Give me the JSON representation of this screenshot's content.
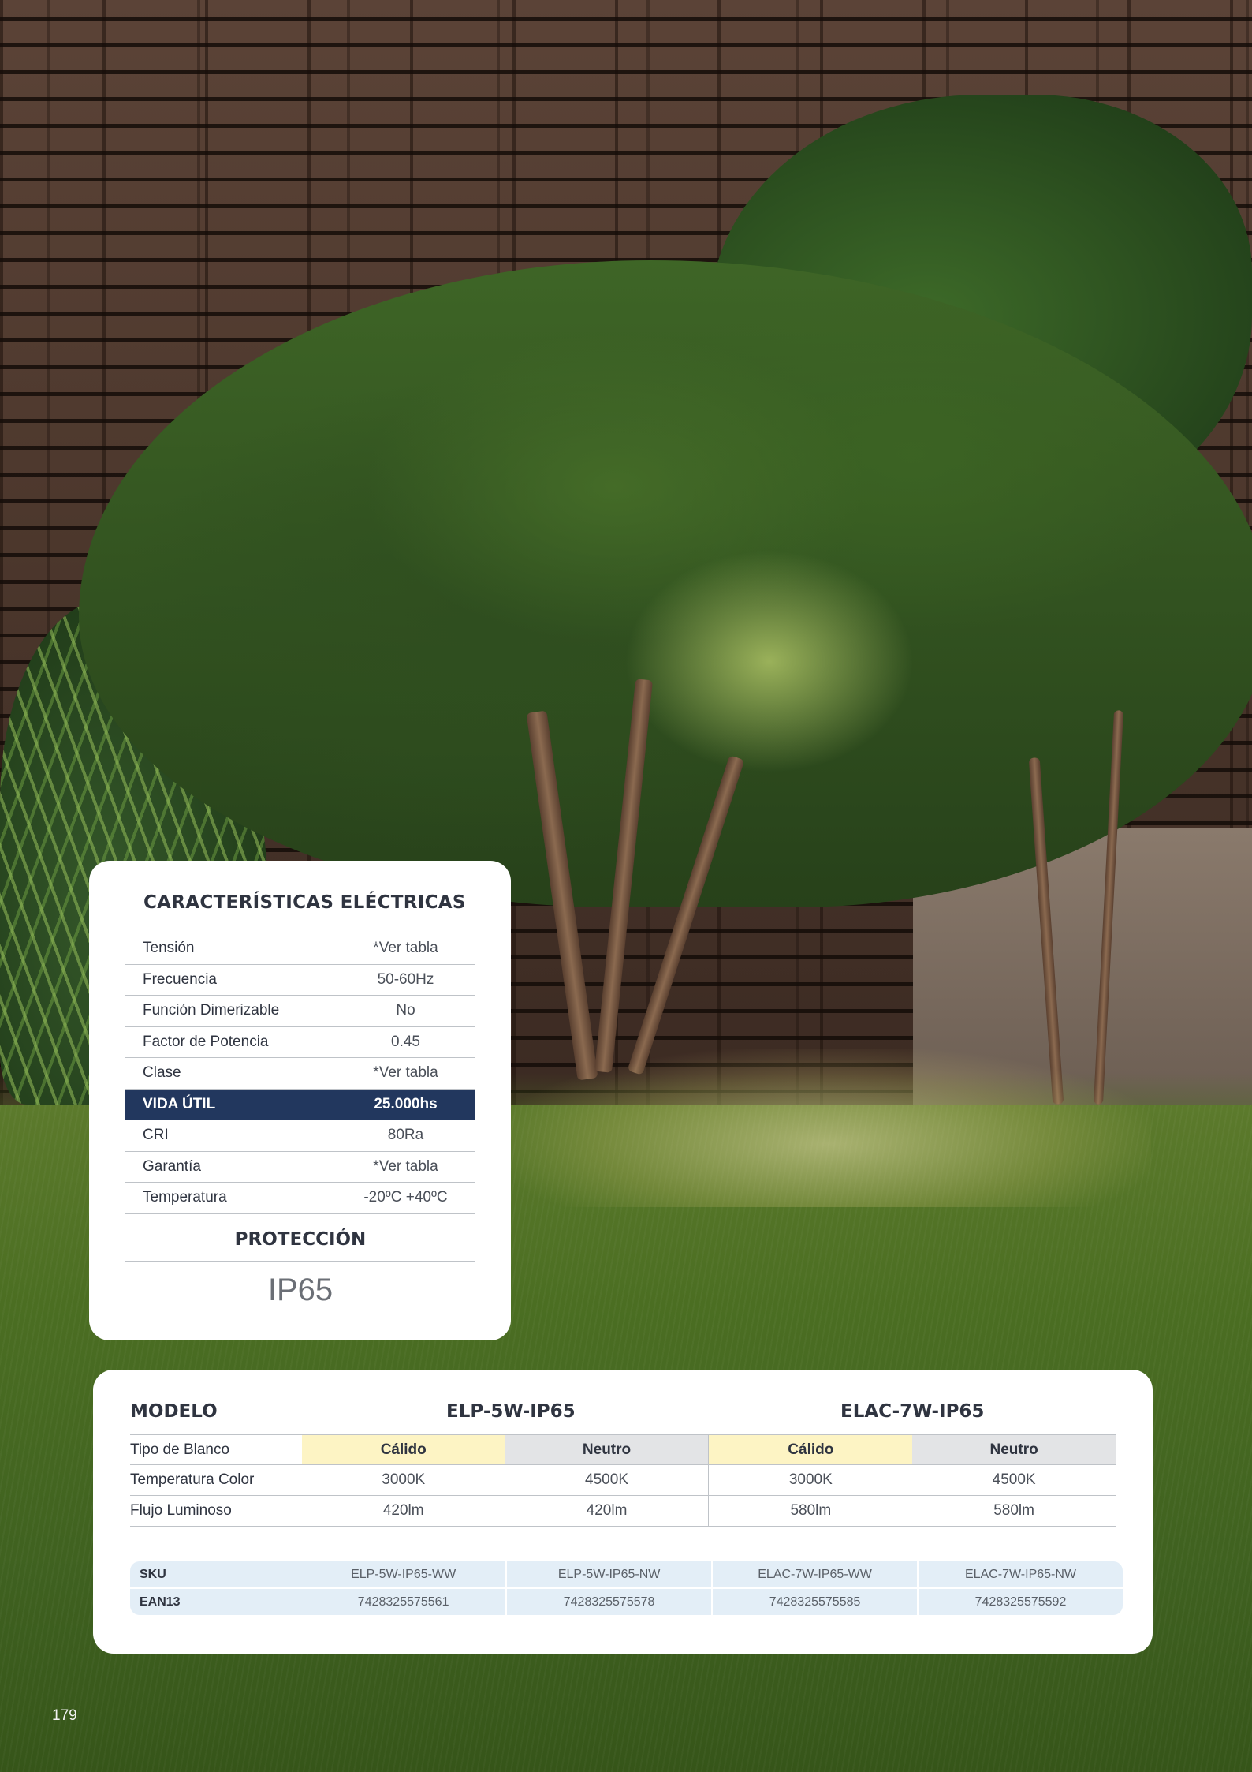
{
  "electrical": {
    "title": "CARACTERÍSTICAS ELÉCTRICAS",
    "rows": [
      {
        "label": "Tensión",
        "value": "*Ver tabla"
      },
      {
        "label": "Frecuencia",
        "value": "50-60Hz"
      },
      {
        "label": "Función Dimerizable",
        "value": "No"
      },
      {
        "label": "Factor de Potencia",
        "value": "0.45"
      },
      {
        "label": "Clase",
        "value": "*Ver tabla"
      },
      {
        "label": "VIDA ÚTIL",
        "value": "25.000hs"
      },
      {
        "label": "CRI",
        "value": "80Ra"
      },
      {
        "label": "Garantía",
        "value": "*Ver tabla"
      },
      {
        "label": "Temperatura",
        "value": "-20ºC +40ºC"
      }
    ],
    "highlight_color": "#22375e"
  },
  "protection": {
    "title": "PROTECCIÓN",
    "value": "IP65"
  },
  "models": {
    "header_label": "MODELO",
    "model_names": [
      "ELP-5W-IP65",
      "ELAC-7W-IP65"
    ],
    "rows": [
      {
        "label": "Tipo de Blanco",
        "values": [
          "Cálido",
          "Neutro",
          "Cálido",
          "Neutro"
        ]
      },
      {
        "label": "Temperatura Color",
        "values": [
          "3000K",
          "4500K",
          "3000K",
          "4500K"
        ]
      },
      {
        "label": "Flujo Luminoso",
        "values": [
          "420lm",
          "420lm",
          "580lm",
          "580lm"
        ]
      }
    ],
    "warm_color": "#fdf4c4",
    "neutral_color": "#e3e4e6"
  },
  "sku_table": {
    "rows": [
      {
        "label": "SKU",
        "values": [
          "ELP-5W-IP65-WW",
          "ELP-5W-IP65-NW",
          "ELAC-7W-IP65-WW",
          "ELAC-7W-IP65-NW"
        ]
      },
      {
        "label": "EAN13",
        "values": [
          "7428325575561",
          "7428325575578",
          "7428325575585",
          "7428325575592"
        ]
      }
    ],
    "row_color": "#e3eef7"
  },
  "page_number": "179"
}
